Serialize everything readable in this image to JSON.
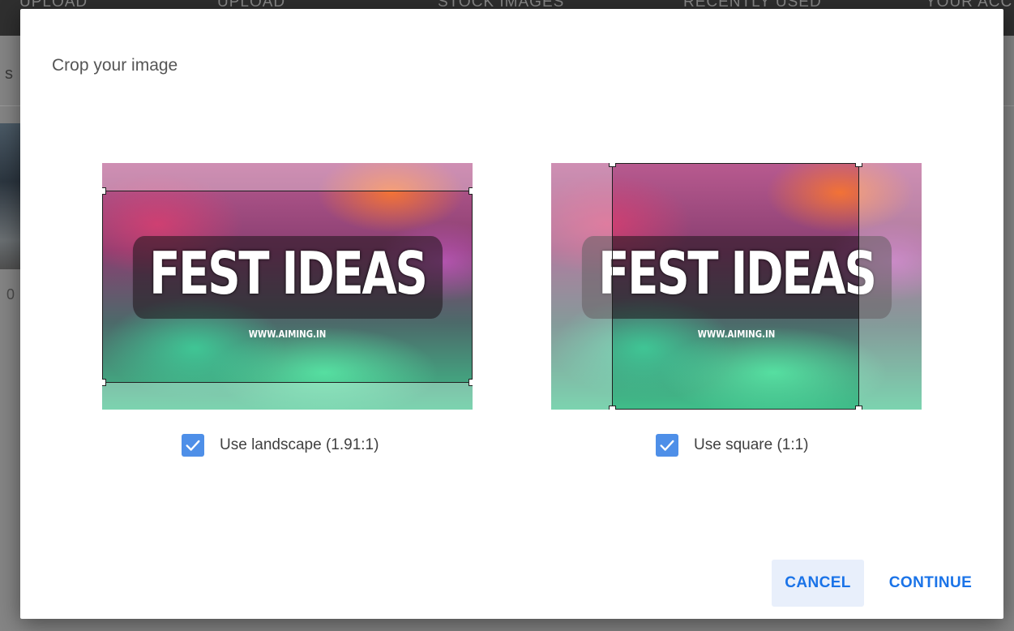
{
  "background_page": {
    "tabs": [
      "UPLOAD",
      "UPLOAD",
      "STOCK IMAGES",
      "RECENTLY USED",
      "YOUR ACC"
    ],
    "side_letter": "s",
    "side_number": "0"
  },
  "dialog": {
    "title": "Crop your image",
    "image_banner": {
      "headline": "FEST IDEAS",
      "url": "WWW.AIMING.IN"
    },
    "options": [
      {
        "label": "Use landscape (1.91:1)",
        "checked": true
      },
      {
        "label": "Use square (1:1)",
        "checked": true
      }
    ],
    "actions": {
      "cancel": "CANCEL",
      "continue": "CONTINUE"
    }
  },
  "colors": {
    "accent": "#1a73e8",
    "checkbox": "#4e8fe8",
    "cancel_bg": "#e8effb"
  },
  "icons": {
    "checkbox": "check-icon"
  }
}
